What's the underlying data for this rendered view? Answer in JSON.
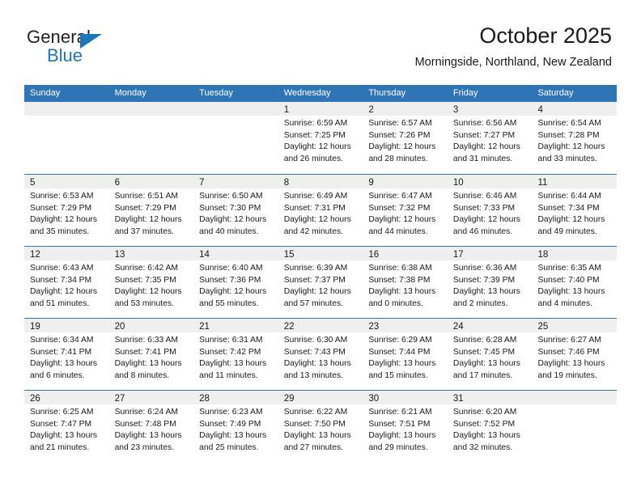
{
  "brand": {
    "name_top": "General",
    "name_bottom": "Blue",
    "triangle_color": "#1b75bb"
  },
  "header": {
    "title": "October 2025",
    "subtitle": "Morningside, Northland, New Zealand"
  },
  "theme": {
    "header_blue": "#2f75b5",
    "row_divider": "#3a74a8",
    "day_band_gray": "#efefef",
    "text": "#1a1a1a"
  },
  "calendar": {
    "weekdays": [
      "Sunday",
      "Monday",
      "Tuesday",
      "Wednesday",
      "Thursday",
      "Friday",
      "Saturday"
    ],
    "weeks": [
      [
        {
          "day": "",
          "empty": true
        },
        {
          "day": "",
          "empty": true
        },
        {
          "day": "",
          "empty": true
        },
        {
          "day": "1",
          "sunrise": "Sunrise: 6:59 AM",
          "sunset": "Sunset: 7:25 PM",
          "daylight1": "Daylight: 12 hours",
          "daylight2": "and 26 minutes."
        },
        {
          "day": "2",
          "sunrise": "Sunrise: 6:57 AM",
          "sunset": "Sunset: 7:26 PM",
          "daylight1": "Daylight: 12 hours",
          "daylight2": "and 28 minutes."
        },
        {
          "day": "3",
          "sunrise": "Sunrise: 6:56 AM",
          "sunset": "Sunset: 7:27 PM",
          "daylight1": "Daylight: 12 hours",
          "daylight2": "and 31 minutes."
        },
        {
          "day": "4",
          "sunrise": "Sunrise: 6:54 AM",
          "sunset": "Sunset: 7:28 PM",
          "daylight1": "Daylight: 12 hours",
          "daylight2": "and 33 minutes."
        }
      ],
      [
        {
          "day": "5",
          "sunrise": "Sunrise: 6:53 AM",
          "sunset": "Sunset: 7:29 PM",
          "daylight1": "Daylight: 12 hours",
          "daylight2": "and 35 minutes."
        },
        {
          "day": "6",
          "sunrise": "Sunrise: 6:51 AM",
          "sunset": "Sunset: 7:29 PM",
          "daylight1": "Daylight: 12 hours",
          "daylight2": "and 37 minutes."
        },
        {
          "day": "7",
          "sunrise": "Sunrise: 6:50 AM",
          "sunset": "Sunset: 7:30 PM",
          "daylight1": "Daylight: 12 hours",
          "daylight2": "and 40 minutes."
        },
        {
          "day": "8",
          "sunrise": "Sunrise: 6:49 AM",
          "sunset": "Sunset: 7:31 PM",
          "daylight1": "Daylight: 12 hours",
          "daylight2": "and 42 minutes."
        },
        {
          "day": "9",
          "sunrise": "Sunrise: 6:47 AM",
          "sunset": "Sunset: 7:32 PM",
          "daylight1": "Daylight: 12 hours",
          "daylight2": "and 44 minutes."
        },
        {
          "day": "10",
          "sunrise": "Sunrise: 6:46 AM",
          "sunset": "Sunset: 7:33 PM",
          "daylight1": "Daylight: 12 hours",
          "daylight2": "and 46 minutes."
        },
        {
          "day": "11",
          "sunrise": "Sunrise: 6:44 AM",
          "sunset": "Sunset: 7:34 PM",
          "daylight1": "Daylight: 12 hours",
          "daylight2": "and 49 minutes."
        }
      ],
      [
        {
          "day": "12",
          "sunrise": "Sunrise: 6:43 AM",
          "sunset": "Sunset: 7:34 PM",
          "daylight1": "Daylight: 12 hours",
          "daylight2": "and 51 minutes."
        },
        {
          "day": "13",
          "sunrise": "Sunrise: 6:42 AM",
          "sunset": "Sunset: 7:35 PM",
          "daylight1": "Daylight: 12 hours",
          "daylight2": "and 53 minutes."
        },
        {
          "day": "14",
          "sunrise": "Sunrise: 6:40 AM",
          "sunset": "Sunset: 7:36 PM",
          "daylight1": "Daylight: 12 hours",
          "daylight2": "and 55 minutes."
        },
        {
          "day": "15",
          "sunrise": "Sunrise: 6:39 AM",
          "sunset": "Sunset: 7:37 PM",
          "daylight1": "Daylight: 12 hours",
          "daylight2": "and 57 minutes."
        },
        {
          "day": "16",
          "sunrise": "Sunrise: 6:38 AM",
          "sunset": "Sunset: 7:38 PM",
          "daylight1": "Daylight: 13 hours",
          "daylight2": "and 0 minutes."
        },
        {
          "day": "17",
          "sunrise": "Sunrise: 6:36 AM",
          "sunset": "Sunset: 7:39 PM",
          "daylight1": "Daylight: 13 hours",
          "daylight2": "and 2 minutes."
        },
        {
          "day": "18",
          "sunrise": "Sunrise: 6:35 AM",
          "sunset": "Sunset: 7:40 PM",
          "daylight1": "Daylight: 13 hours",
          "daylight2": "and 4 minutes."
        }
      ],
      [
        {
          "day": "19",
          "sunrise": "Sunrise: 6:34 AM",
          "sunset": "Sunset: 7:41 PM",
          "daylight1": "Daylight: 13 hours",
          "daylight2": "and 6 minutes."
        },
        {
          "day": "20",
          "sunrise": "Sunrise: 6:33 AM",
          "sunset": "Sunset: 7:41 PM",
          "daylight1": "Daylight: 13 hours",
          "daylight2": "and 8 minutes."
        },
        {
          "day": "21",
          "sunrise": "Sunrise: 6:31 AM",
          "sunset": "Sunset: 7:42 PM",
          "daylight1": "Daylight: 13 hours",
          "daylight2": "and 11 minutes."
        },
        {
          "day": "22",
          "sunrise": "Sunrise: 6:30 AM",
          "sunset": "Sunset: 7:43 PM",
          "daylight1": "Daylight: 13 hours",
          "daylight2": "and 13 minutes."
        },
        {
          "day": "23",
          "sunrise": "Sunrise: 6:29 AM",
          "sunset": "Sunset: 7:44 PM",
          "daylight1": "Daylight: 13 hours",
          "daylight2": "and 15 minutes."
        },
        {
          "day": "24",
          "sunrise": "Sunrise: 6:28 AM",
          "sunset": "Sunset: 7:45 PM",
          "daylight1": "Daylight: 13 hours",
          "daylight2": "and 17 minutes."
        },
        {
          "day": "25",
          "sunrise": "Sunrise: 6:27 AM",
          "sunset": "Sunset: 7:46 PM",
          "daylight1": "Daylight: 13 hours",
          "daylight2": "and 19 minutes."
        }
      ],
      [
        {
          "day": "26",
          "sunrise": "Sunrise: 6:25 AM",
          "sunset": "Sunset: 7:47 PM",
          "daylight1": "Daylight: 13 hours",
          "daylight2": "and 21 minutes."
        },
        {
          "day": "27",
          "sunrise": "Sunrise: 6:24 AM",
          "sunset": "Sunset: 7:48 PM",
          "daylight1": "Daylight: 13 hours",
          "daylight2": "and 23 minutes."
        },
        {
          "day": "28",
          "sunrise": "Sunrise: 6:23 AM",
          "sunset": "Sunset: 7:49 PM",
          "daylight1": "Daylight: 13 hours",
          "daylight2": "and 25 minutes."
        },
        {
          "day": "29",
          "sunrise": "Sunrise: 6:22 AM",
          "sunset": "Sunset: 7:50 PM",
          "daylight1": "Daylight: 13 hours",
          "daylight2": "and 27 minutes."
        },
        {
          "day": "30",
          "sunrise": "Sunrise: 6:21 AM",
          "sunset": "Sunset: 7:51 PM",
          "daylight1": "Daylight: 13 hours",
          "daylight2": "and 29 minutes."
        },
        {
          "day": "31",
          "sunrise": "Sunrise: 6:20 AM",
          "sunset": "Sunset: 7:52 PM",
          "daylight1": "Daylight: 13 hours",
          "daylight2": "and 32 minutes."
        },
        {
          "day": "",
          "empty": true
        }
      ]
    ]
  }
}
